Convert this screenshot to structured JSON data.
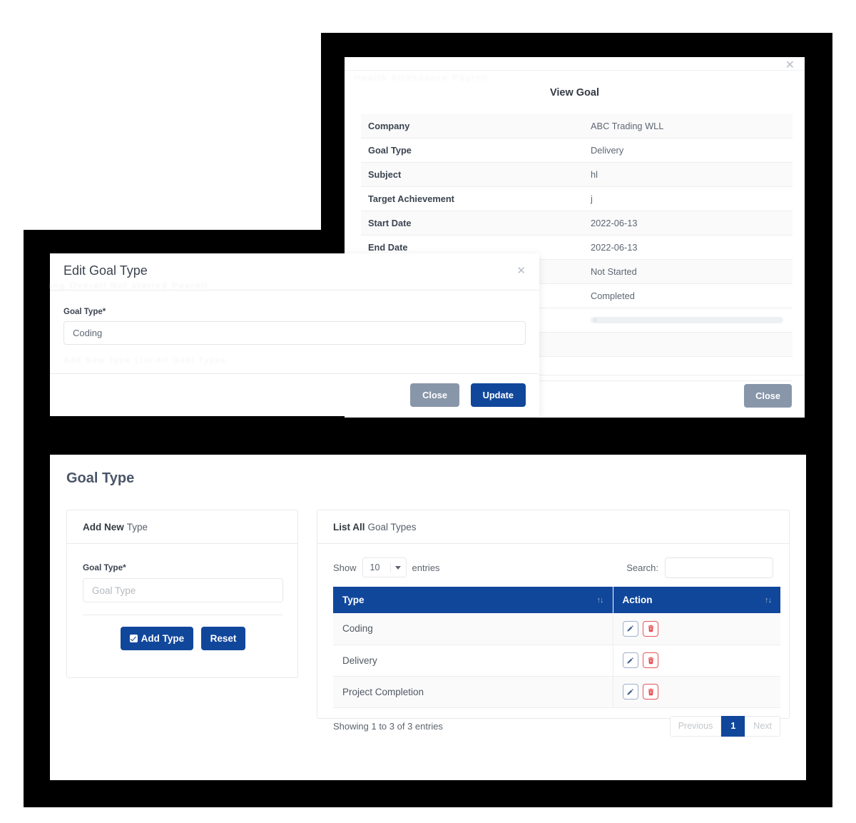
{
  "view_goal": {
    "title": "View Goal",
    "close_icon": "close-icon",
    "close_label": "Close",
    "rows": [
      {
        "label": "Company",
        "value": "ABC Trading WLL"
      },
      {
        "label": "Goal Type",
        "value": "Delivery"
      },
      {
        "label": "Subject",
        "value": "hl"
      },
      {
        "label": "Target Achievement",
        "value": "j"
      },
      {
        "label": "Start Date",
        "value": "2022-06-13"
      },
      {
        "label": "End Date",
        "value": "2022-06-13"
      },
      {
        "label": "",
        "value": "Not Started"
      },
      {
        "label": "",
        "value": "Completed"
      }
    ]
  },
  "edit_modal": {
    "title": "Edit Goal Type",
    "close_icon": "close-icon",
    "field_label": "Goal Type*",
    "field_value": "Coding",
    "close_label": "Close",
    "update_label": "Update"
  },
  "page": {
    "title": "Goal Type"
  },
  "add_panel": {
    "head_bold": "Add New",
    "head_rest": "Type",
    "field_label": "Goal Type*",
    "field_placeholder": "Goal Type",
    "field_value": "",
    "add_label": "Add Type",
    "reset_label": "Reset"
  },
  "list_panel": {
    "head_bold": "List All",
    "head_rest": "Goal Types",
    "show_label": "Show",
    "show_value": "10",
    "entries_label": "entries",
    "search_label": "Search:",
    "search_value": "",
    "columns": [
      "Type",
      "Action"
    ],
    "sort_icon": "sort-updown-icon",
    "rows": [
      {
        "type": "Coding",
        "edit_icon": "pencil-icon",
        "delete_icon": "trash-icon"
      },
      {
        "type": "Delivery",
        "edit_icon": "pencil-icon",
        "delete_icon": "trash-icon"
      },
      {
        "type": "Project Completion",
        "edit_icon": "pencil-icon",
        "delete_icon": "trash-icon"
      }
    ],
    "showing_info": "Showing 1 to 3 of 3 entries",
    "pagination": {
      "previous": "Previous",
      "page": "1",
      "next": "Next"
    }
  },
  "colors": {
    "primary": "#11479b",
    "secondary": "#8896aa",
    "danger": "#e8545a",
    "backdrop": "#000000"
  }
}
